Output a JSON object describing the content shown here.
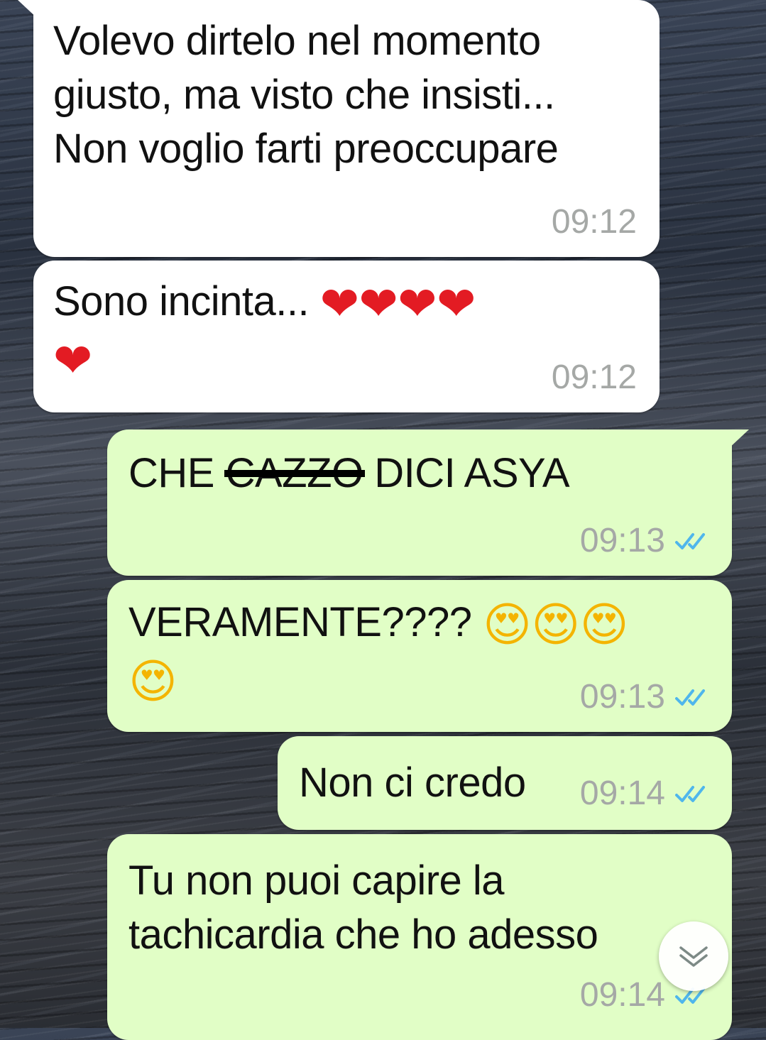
{
  "messages": [
    {
      "direction": "incoming",
      "text": "Volevo dirtelo nel momento giusto, ma visto che insisti... Non voglio farti preoccupare",
      "lines": [
        "Volevo dirtelo nel momento",
        "giusto, ma visto che insisti...",
        "Non voglio farti preoccupare"
      ],
      "time": "09:12"
    },
    {
      "direction": "incoming",
      "text": "Sono incinta...",
      "emoji_line1": "❤❤❤❤",
      "emoji_line2": "❤",
      "time": "09:12"
    },
    {
      "direction": "outgoing",
      "text_before": "CHE",
      "text_struck": "CAZZO",
      "text_after": "DICI ASYA",
      "time": "09:13",
      "status": "read"
    },
    {
      "direction": "outgoing",
      "text": "VERAMENTE????",
      "emoji_line1": "😍😍😍",
      "emoji_line2": "😍",
      "time": "09:13",
      "status": "read"
    },
    {
      "direction": "outgoing",
      "text": "Non ci credo",
      "time": "09:14",
      "status": "read"
    },
    {
      "direction": "outgoing",
      "lines": [
        "Tu non puoi capire la",
        "tachicardia che ho adesso"
      ],
      "time": "09:14",
      "status": "read"
    }
  ],
  "colors": {
    "incoming_bubble": "#ffffff",
    "outgoing_bubble": "#e1fec6",
    "read_ticks": "#4fb6ec",
    "timestamp": "#a5a8a6"
  },
  "scroll_button": {
    "icon": "chevron-down-icon"
  }
}
